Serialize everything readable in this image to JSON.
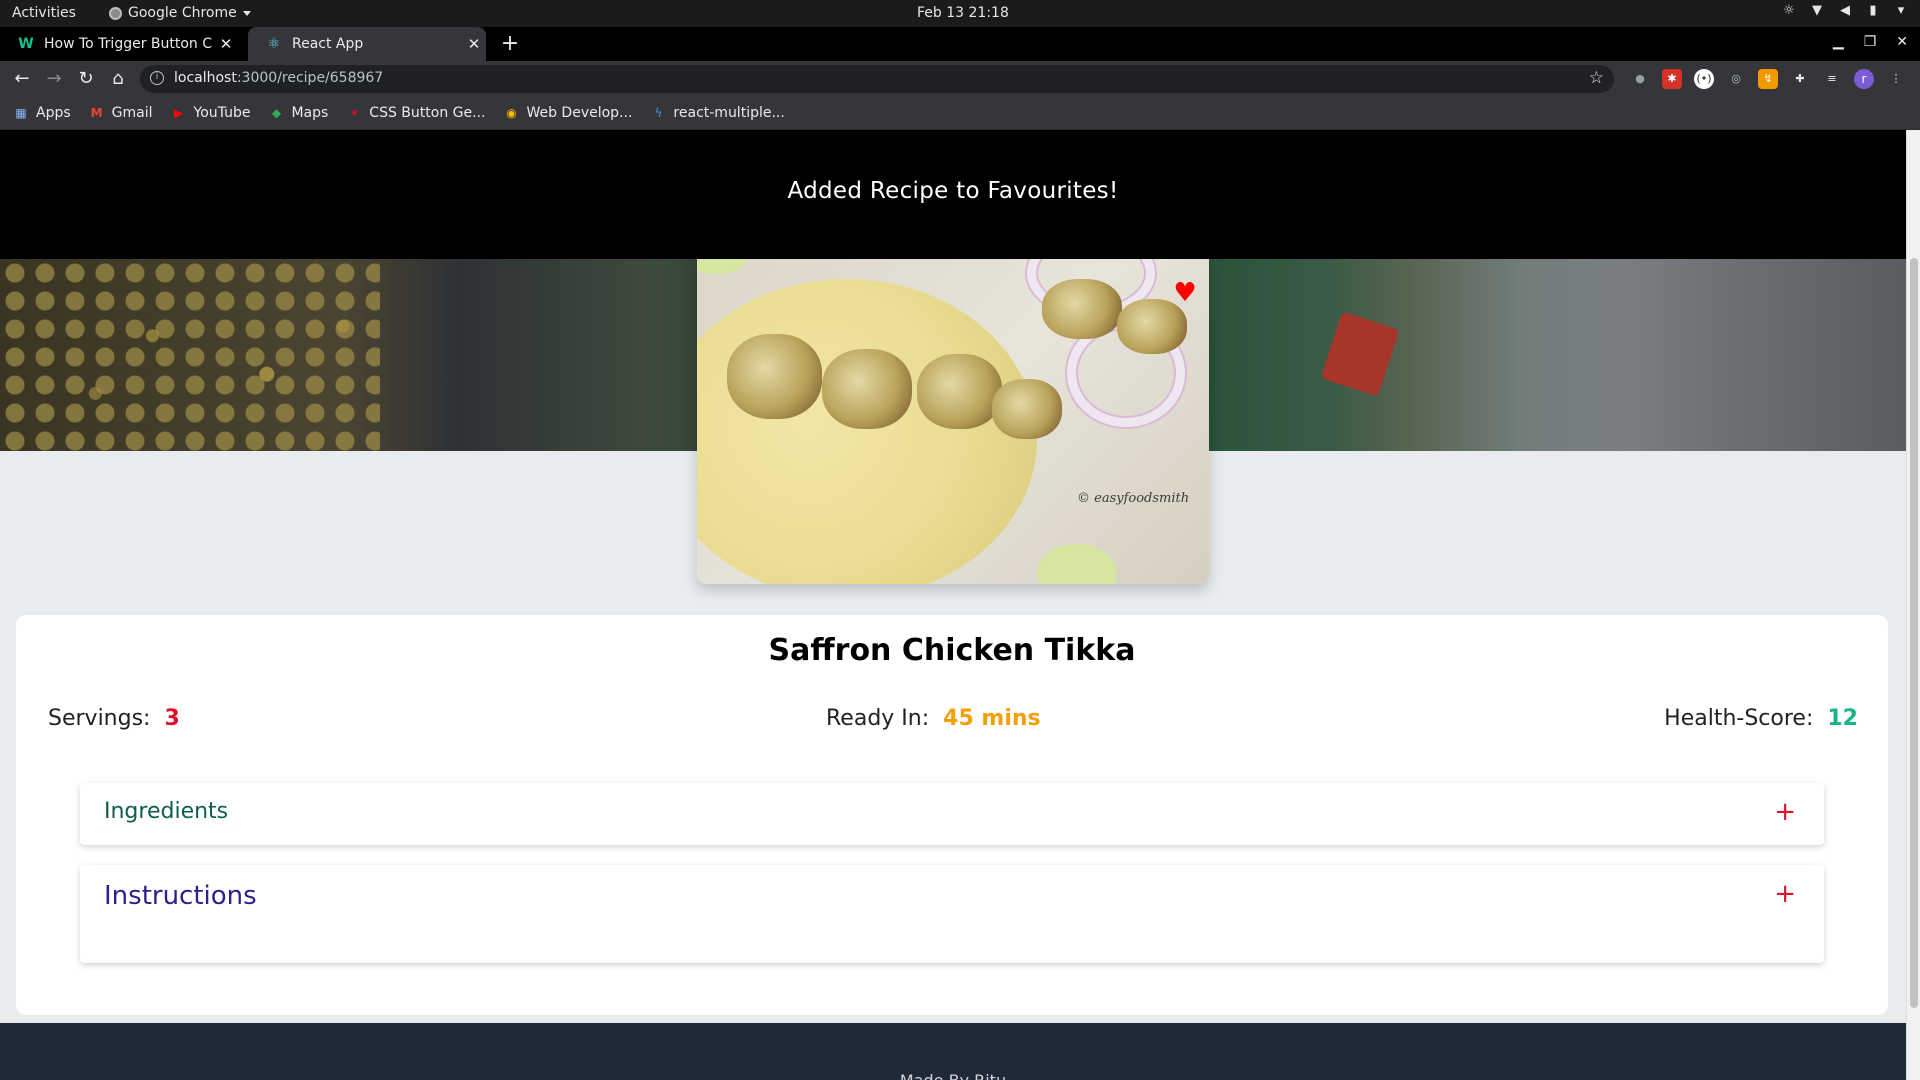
{
  "os": {
    "activities": "Activities",
    "app_name": "Google Chrome",
    "clock": "Feb 13  21:18"
  },
  "browser": {
    "tabs": [
      {
        "title": "How To Trigger Button Cl",
        "icon": "w-icon",
        "active": false
      },
      {
        "title": "React App",
        "icon": "react-icon",
        "active": true
      }
    ],
    "url": {
      "host": "localhost",
      "path": ":3000/recipe/658967"
    },
    "bookmarks": [
      {
        "label": "Apps",
        "icon": "apps-grid-icon"
      },
      {
        "label": "Gmail",
        "icon": "gmail-icon"
      },
      {
        "label": "YouTube",
        "icon": "youtube-icon"
      },
      {
        "label": "Maps",
        "icon": "maps-icon"
      },
      {
        "label": "CSS Button Ge...",
        "icon": "star-burst-icon"
      },
      {
        "label": "Web Develop...",
        "icon": "web-dev-icon"
      },
      {
        "label": "react-multiple...",
        "icon": "bolt-icon"
      }
    ],
    "profile_initial": "r"
  },
  "page": {
    "notification": "Added Recipe to Favourites!",
    "image_watermark": "© easyfoodsmith",
    "recipe": {
      "title": "Saffron Chicken Tikka",
      "servings_label": "Servings:",
      "servings_value": "3",
      "ready_label": "Ready In:",
      "ready_value": "45 mins",
      "health_label": "Health-Score:",
      "health_value": "12"
    },
    "sections": {
      "ingredients": "Ingredients",
      "instructions": "Instructions",
      "expand_symbol": "+"
    },
    "footer_text": "Made By Ritu"
  },
  "colors": {
    "servings": "#e0102a",
    "ready": "#f5a00b",
    "health": "#19b38a",
    "favourite": "#ff0000"
  }
}
